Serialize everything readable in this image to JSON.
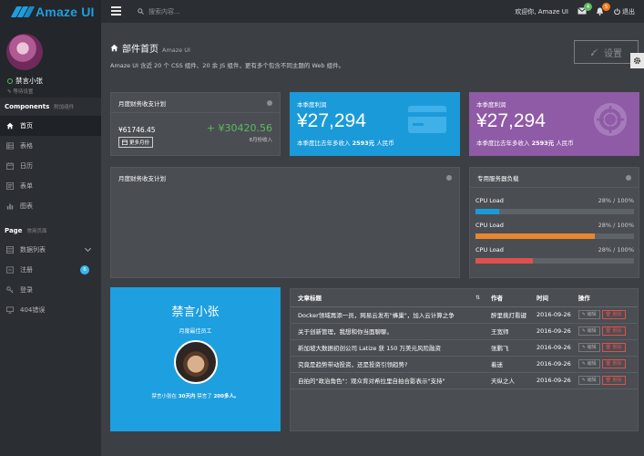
{
  "header": {
    "logo_text": "Amaze UI",
    "search_placeholder": "搜索内容...",
    "welcome": "欢迎你, Amaze UI",
    "mail_count": "4",
    "bell_count": "5",
    "logout": "退出"
  },
  "sidebar": {
    "user_name": "禁言小张",
    "user_status": "等待设置",
    "components_title": "Components",
    "components_sub": "附加组件",
    "components_items": [
      {
        "label": "首页",
        "icon": "home-icon"
      },
      {
        "label": "表格",
        "icon": "table-icon"
      },
      {
        "label": "日历",
        "icon": "calendar-icon"
      },
      {
        "label": "表单",
        "icon": "form-icon"
      },
      {
        "label": "图表",
        "icon": "chart-icon"
      }
    ],
    "page_title": "Page",
    "page_sub": "常用页面",
    "page_items": [
      {
        "label": "数据列表",
        "icon": "list-icon"
      },
      {
        "label": "注册",
        "icon": "register-icon",
        "badge": "6"
      },
      {
        "label": "登录",
        "icon": "key-icon"
      },
      {
        "label": "404错误",
        "icon": "monitor-icon"
      }
    ]
  },
  "page": {
    "title": "部件首页",
    "title_sub": "Amaze UI",
    "description": "Amaze UI 含近 20 个 CSS 组件、20 余 JS 组件，更有多个包含不同主题的 Web 组件。",
    "settings_label": "设置"
  },
  "finance": {
    "title": "月度财务收支计划",
    "amount_left": "¥61746.45",
    "amount_right": "+ ¥30420.56",
    "month_label": "8月份收入",
    "more_button": "更多月份"
  },
  "stats": [
    {
      "label": "本季度利润",
      "value": "¥27,294",
      "sub_prefix": "本季度比去年多收入",
      "sub_value": "2593元",
      "sub_suffix": "人民币",
      "color": "#1b9ad9"
    },
    {
      "label": "本季度利润",
      "value": "¥27,294",
      "sub_prefix": "本季度比去年多收入",
      "sub_value": "2593元",
      "sub_suffix": "人民币",
      "color": "#8f5aa6"
    }
  ],
  "plan_panel": {
    "title": "月度财务收支计划"
  },
  "server": {
    "title": "专用服务器负载",
    "items": [
      {
        "label": "CPU Load",
        "value": "28% / 100%",
        "fill": 0.15,
        "color": "#1b9ad9"
      },
      {
        "label": "CPU Load",
        "value": "28% / 100%",
        "fill": 0.75,
        "color": "#e9862d"
      },
      {
        "label": "CPU Load",
        "value": "28% / 100%",
        "fill": 0.36,
        "color": "#dd514c"
      }
    ]
  },
  "profile_card": {
    "name": "禁言小张",
    "role": "月度最佳员工",
    "desc_prefix": "禁言小张在",
    "desc_days": "30天内",
    "desc_mid": "禁言了",
    "desc_count": "200多人。"
  },
  "articles": {
    "headers": [
      "文章标题",
      "作者",
      "时间",
      "操作"
    ],
    "edit_label": "编辑",
    "delete_label": "删除",
    "rows": [
      {
        "title": "Docker领域再添一员，网易云发布\"蜂巢\"，加入云计算之争",
        "author": "醉里挑灯看键",
        "date": "2016-09-26"
      },
      {
        "title": "关于创新管理，我想和你当面聊聊。",
        "author": "王宽师",
        "date": "2016-09-26"
      },
      {
        "title": "新加坡大数据初创公司 Latize 获 150 万美元风险融资",
        "author": "张鹏飞",
        "date": "2016-09-26"
      },
      {
        "title": "究竟是趋势带动投资，还是投资引领趋势?",
        "author": "着迷",
        "date": "2016-09-26"
      },
      {
        "title": "自拍的\"政治角色\"：观众背对希拉里自拍合影表示\"支持\"",
        "author": "天纵之人",
        "date": "2016-09-26"
      }
    ]
  }
}
